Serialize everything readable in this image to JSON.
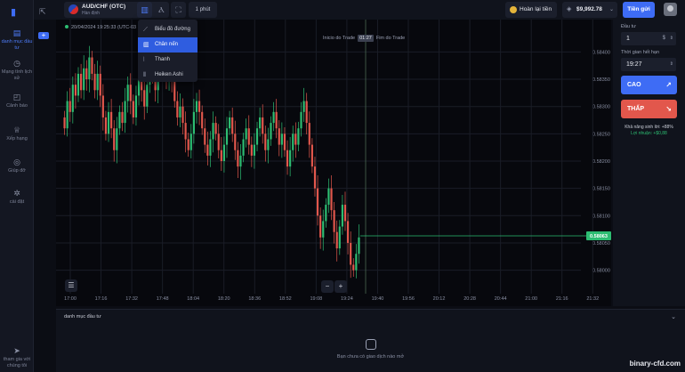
{
  "app": {
    "watermark": "binary-cfd.com"
  },
  "sidebar": {
    "items": [
      {
        "name": "investment-portfolio",
        "label": "danh mục đầu tư",
        "icon": "portfolio-icon",
        "active": true
      },
      {
        "name": "history",
        "label": "Mạng tình lịch sử",
        "icon": "history-icon",
        "active": false
      },
      {
        "name": "alerts",
        "label": "Cảnh báo",
        "icon": "bell-icon",
        "active": false
      },
      {
        "name": "ranking",
        "label": "Xếp hạng",
        "icon": "trophy-icon",
        "active": false
      },
      {
        "name": "help",
        "label": "Giúp đỡ",
        "icon": "help-icon",
        "active": false
      },
      {
        "name": "settings",
        "label": "cài đặt",
        "icon": "gear-icon",
        "active": false
      }
    ],
    "join_chat": "tham gia với chúng tôi"
  },
  "topbar": {
    "asset_name": "AUD/CHF (OTC)",
    "asset_sub": "Hàn định",
    "timeframe": "1 phút",
    "refund_label": "Hoàn lại tiền",
    "balance": "$9,992.78",
    "deposit_label": "Tiền gửi"
  },
  "chart_menu": {
    "items": [
      {
        "label": "Biểu đồ đường",
        "icon": "line-chart-icon",
        "selected": false
      },
      {
        "label": "Chân nến",
        "icon": "candlestick-icon",
        "selected": true
      },
      {
        "label": "Thanh",
        "icon": "bar-chart-icon",
        "selected": false
      },
      {
        "label": "Heiken Ashi",
        "icon": "heiken-ashi-icon",
        "selected": false
      }
    ]
  },
  "chart_info": {
    "datetime": "20/04/2024  19:25:33  (UTC-03",
    "start_label": "Inicio do Trade",
    "time_badge": "01:27",
    "end_label": "Fim do Trade"
  },
  "chart_data": {
    "type": "candlestick",
    "title": "AUD/CHF (OTC)",
    "x_ticks": [
      "17:00",
      "17:16",
      "17:32",
      "17:48",
      "18:04",
      "18:20",
      "18:36",
      "18:52",
      "19:08",
      "19:24",
      "19:40",
      "19:56",
      "20:12",
      "20:28",
      "20:44",
      "21:00",
      "21:16",
      "21:32"
    ],
    "y_ticks": [
      "0.58400",
      "0.58350",
      "0.58300",
      "0.58250",
      "0.58200",
      "0.58150",
      "0.58100",
      "0.58050",
      "0.58000"
    ],
    "ylim": [
      0.5797,
      0.5843
    ],
    "current_price": "0.58063",
    "current_price_value": 0.58063,
    "grid": true,
    "up_color": "#2dbd72",
    "down_color": "#e2574c",
    "close_series": [
      0.5826,
      0.5831,
      0.5829,
      0.5834,
      0.5832,
      0.5836,
      0.5833,
      0.5837,
      0.5835,
      0.5839,
      0.5836,
      0.5833,
      0.5836,
      0.5832,
      0.5828,
      0.5825,
      0.5829,
      0.5826,
      0.5822,
      0.5826,
      0.5829,
      0.5827,
      0.5831,
      0.5834,
      0.5831,
      0.5828,
      0.5832,
      0.5835,
      0.5833,
      0.583,
      0.5834,
      0.5838,
      0.5836,
      0.5833,
      0.5837,
      0.584,
      0.5838,
      0.5835,
      0.5838,
      0.5835,
      0.5831,
      0.5828,
      0.583,
      0.5827,
      0.5824,
      0.5822,
      0.5825,
      0.5829,
      0.5831,
      0.5829,
      0.5826,
      0.5823,
      0.5821,
      0.5824,
      0.5827,
      0.5825,
      0.5822,
      0.582,
      0.5823,
      0.5826,
      0.5828,
      0.5825,
      0.5822,
      0.5819,
      0.5821,
      0.5824,
      0.5826,
      0.5823,
      0.5821,
      0.5823,
      0.5826,
      0.5828,
      0.5825,
      0.5822,
      0.5824,
      0.5827,
      0.5829,
      0.5826,
      0.5823,
      0.5825,
      0.5822,
      0.5819,
      0.5822,
      0.5825,
      0.5823,
      0.5826,
      0.5829,
      0.5831,
      0.5827,
      0.5823,
      0.5819,
      0.5815,
      0.581,
      0.5806,
      0.5809,
      0.5812,
      0.5815,
      0.5811,
      0.5807,
      0.5804,
      0.5808,
      0.5812,
      0.5809,
      0.5805,
      0.5801,
      0.58,
      0.5803,
      0.5806
    ]
  },
  "trade_panel": {
    "invest_label": "Đầu tư",
    "invest_value": "1",
    "invest_suffix": "$",
    "time_label": "Thời gian hết hạn",
    "time_value": "19:27",
    "up_label": "CAO",
    "down_label": "THẤP",
    "profit_rate": "Khả năng sinh lời: +88%",
    "profit_amount": "Lợi nhuận: +$0,88"
  },
  "portfolio": {
    "title": "danh mục đầu tư",
    "empty_text": "Bạn chưa có giao dịch nào mở"
  }
}
